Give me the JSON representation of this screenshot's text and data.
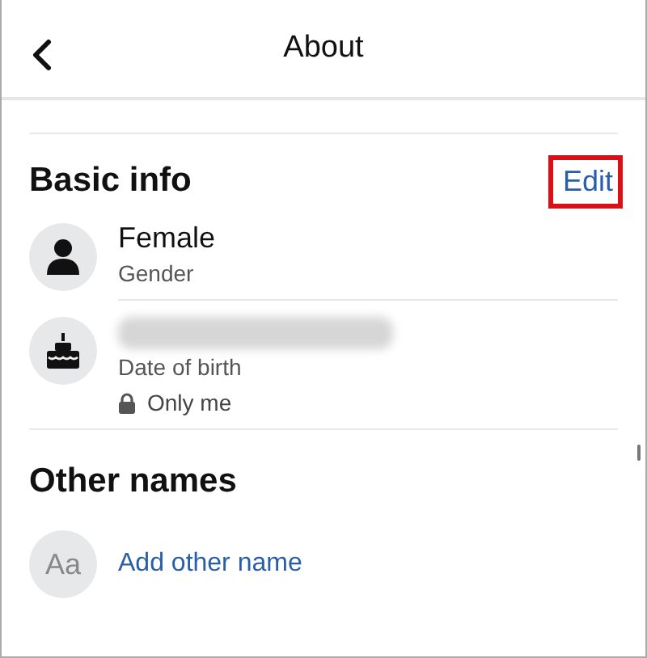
{
  "header": {
    "title": "About"
  },
  "basic_info": {
    "title": "Basic info",
    "edit": {
      "label": "Edit",
      "highlighted": true
    },
    "items": [
      {
        "kind": "gender",
        "value": "Female",
        "label": "Gender"
      },
      {
        "kind": "birthday",
        "value_redacted": true,
        "label": "Date of birth",
        "privacy": "Only me"
      }
    ]
  },
  "other_names": {
    "title": "Other names",
    "icon_text": "Aa",
    "action": "Add other name"
  }
}
